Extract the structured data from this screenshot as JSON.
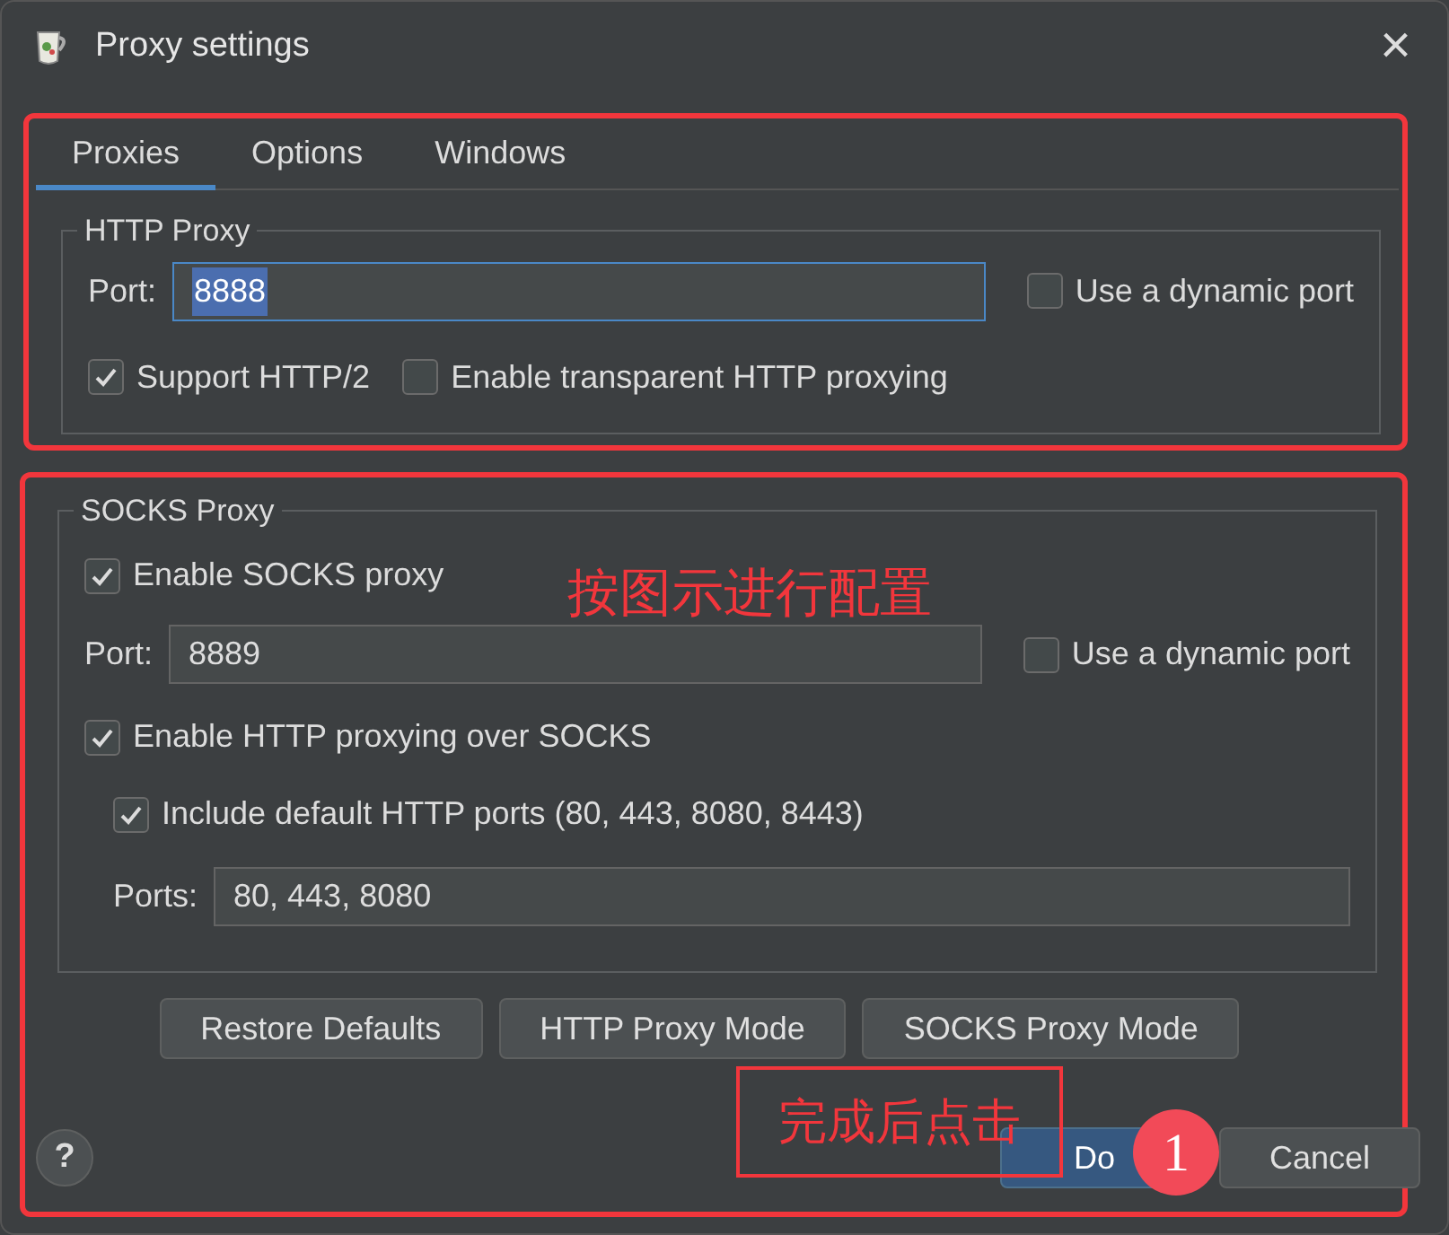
{
  "window": {
    "title": "Proxy settings",
    "close": "×"
  },
  "tabs": [
    {
      "label": "Proxies",
      "selected": true
    },
    {
      "label": "Options",
      "selected": false
    },
    {
      "label": "Windows",
      "selected": false
    }
  ],
  "http_proxy": {
    "title": "HTTP Proxy",
    "port_label": "Port:",
    "port_value": "8888",
    "focused": true,
    "text_selected": true,
    "dynamic_port": {
      "label": "Use a dynamic port",
      "checked": false
    },
    "options": [
      {
        "label": "Support HTTP/2",
        "checked": true
      },
      {
        "label": "Enable transparent HTTP proxying",
        "checked": false
      }
    ]
  },
  "socks_proxy": {
    "title": "SOCKS Proxy",
    "enable": {
      "label": "Enable SOCKS proxy",
      "checked": true
    },
    "port_label": "Port:",
    "port_value": "8889",
    "focused": false,
    "text_selected": false,
    "dynamic_port": {
      "label": "Use a dynamic port",
      "checked": false
    },
    "http_over_socks": {
      "label": "Enable HTTP proxying over SOCKS",
      "checked": true
    },
    "include_default": {
      "label": "Include default HTTP ports (80, 443, 8080, 8443)",
      "checked": true
    },
    "ports_label": "Ports:",
    "ports_value": "80, 443, 8080"
  },
  "mode_buttons": [
    "Restore Defaults",
    "HTTP Proxy Mode",
    "SOCKS Proxy Mode"
  ],
  "help": "?",
  "buttons": [
    {
      "label": "Do",
      "kind": "primary"
    },
    {
      "label": "Cancel",
      "kind": "secondary"
    }
  ],
  "annotations": [
    {
      "kind": "note",
      "text": "按图示进行配置"
    },
    {
      "kind": "callout",
      "text": "完成后点击"
    },
    {
      "kind": "step",
      "text": "1"
    }
  ]
}
